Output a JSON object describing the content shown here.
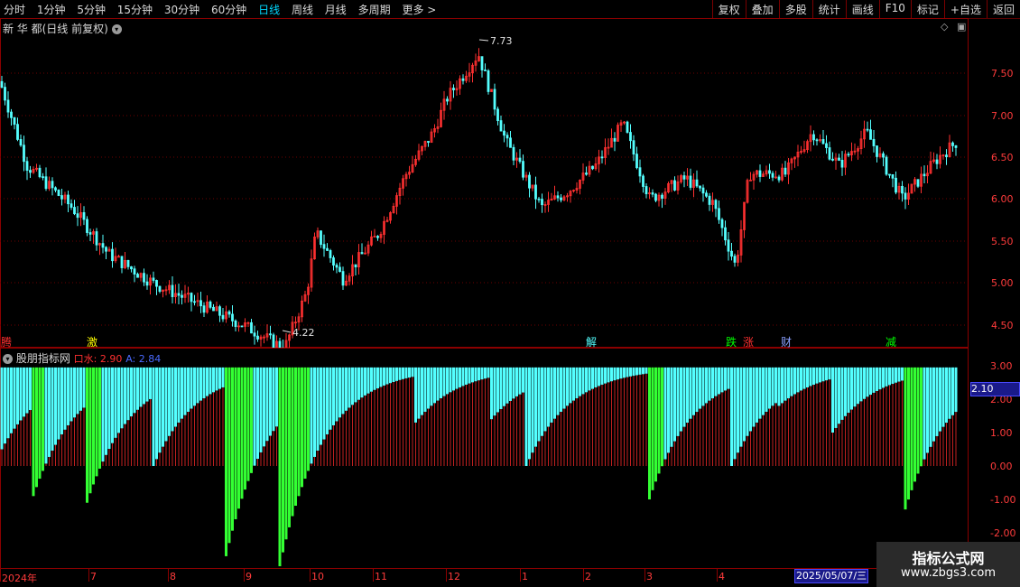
{
  "toolbar": {
    "periods": [
      "分时",
      "1分钟",
      "5分钟",
      "15分钟",
      "30分钟",
      "60分钟",
      "日线",
      "周线",
      "月线",
      "多周期",
      "更多 >"
    ],
    "active_period": "日线",
    "actions": [
      "复权",
      "叠加",
      "多股",
      "统计",
      "画线",
      "F10",
      "标记",
      "+自选",
      "返回"
    ]
  },
  "main_chart": {
    "title": "新 华 都(日线 前复权)",
    "high_label": "7.73",
    "low_label": "4.22",
    "y_ticks": [
      "7.50",
      "7.00",
      "6.50",
      "6.00",
      "5.50",
      "5.00",
      "4.50"
    ],
    "up_color": "#ff3030",
    "down_color": "#54ffff"
  },
  "event_tags": [
    {
      "text": "腾",
      "color": "#ff3030"
    },
    {
      "text": "激",
      "color": "#ffff00"
    },
    {
      "text": "解",
      "color": "#54ffff"
    },
    {
      "text": "跌",
      "color": "#00ff00"
    },
    {
      "text": "涨",
      "color": "#ff3030"
    },
    {
      "text": "财",
      "color": "#8aa0ff"
    },
    {
      "text": "减",
      "color": "#00ff00"
    }
  ],
  "indicator": {
    "name": "股朋指标网",
    "kou_label": "口水: 2.90",
    "a_label": "A: 2.84",
    "y_ticks": [
      "3.00",
      "2.00",
      "1.00",
      "0.00",
      "-1.00",
      "-2.00"
    ],
    "current_value": "2.10"
  },
  "x_axis": {
    "labels": [
      "2024年",
      "7",
      "8",
      "9",
      "10",
      "11",
      "12",
      "1",
      "2",
      "3",
      "4"
    ],
    "cursor_date": "2025/05/07/三"
  },
  "watermark": {
    "line1": "指标公式网",
    "line2": "www.zbgs3.com"
  }
}
